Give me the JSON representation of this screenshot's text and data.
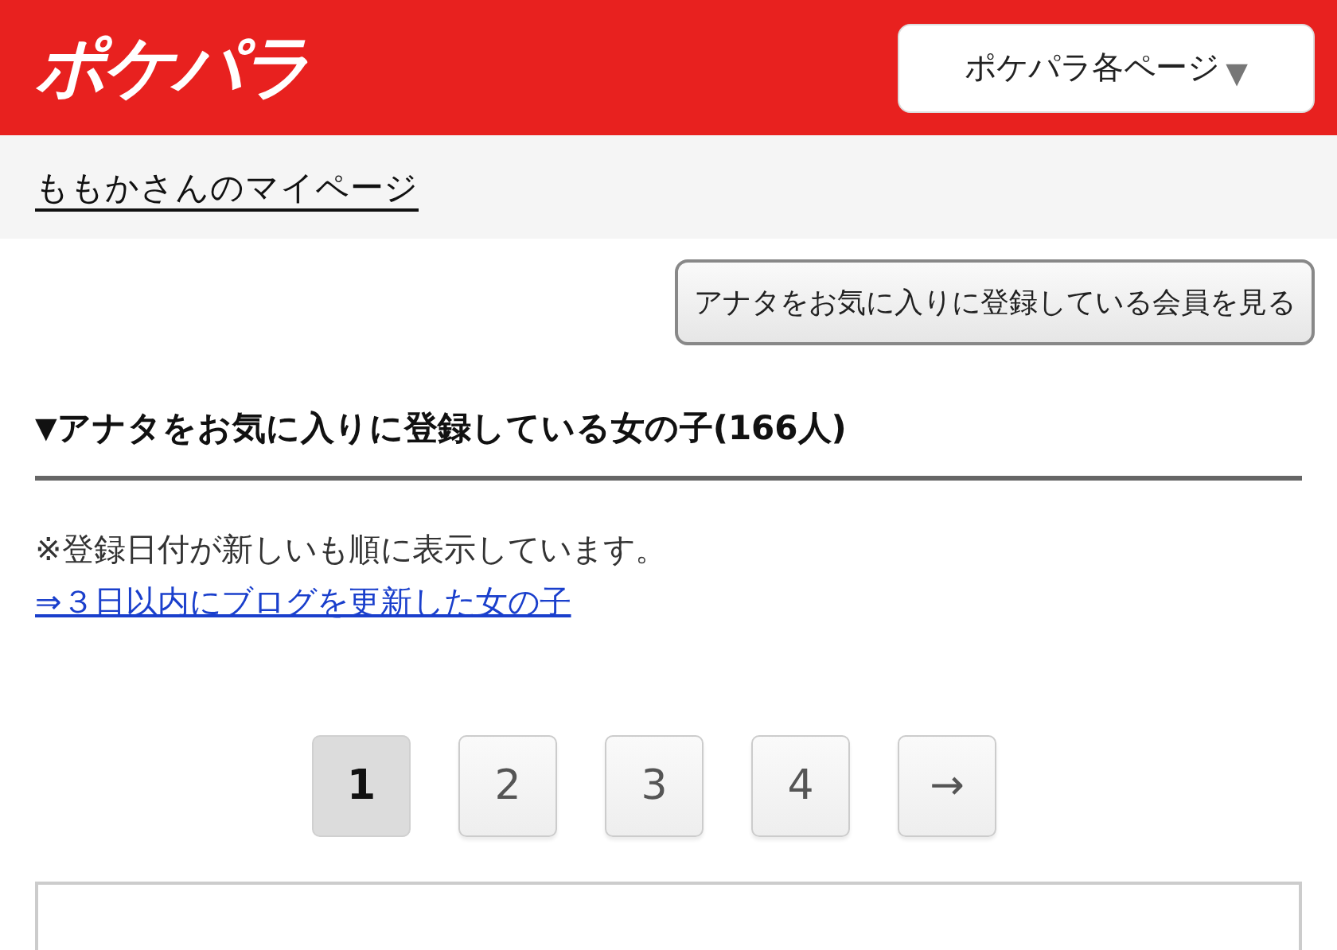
{
  "header": {
    "logo": "ポケパラ",
    "menu_button": "ポケパラ各ページ",
    "menu_caret": "▼"
  },
  "breadcrumb": "ももかさんのマイページ",
  "action_button": "アナタをお気に入りに登録している会員を見る",
  "section": {
    "marker": "▼",
    "title": "アナタをお気に入りに登録している女の子(166人)"
  },
  "note": "※登録日付が新しいも順に表示しています。",
  "link": "⇒３日以内にブログを更新した女の子",
  "pagination": [
    {
      "label": "1",
      "selected": true
    },
    {
      "label": "2",
      "selected": false
    },
    {
      "label": "3",
      "selected": false
    },
    {
      "label": "4",
      "selected": false
    },
    {
      "label": "→",
      "selected": false
    }
  ]
}
